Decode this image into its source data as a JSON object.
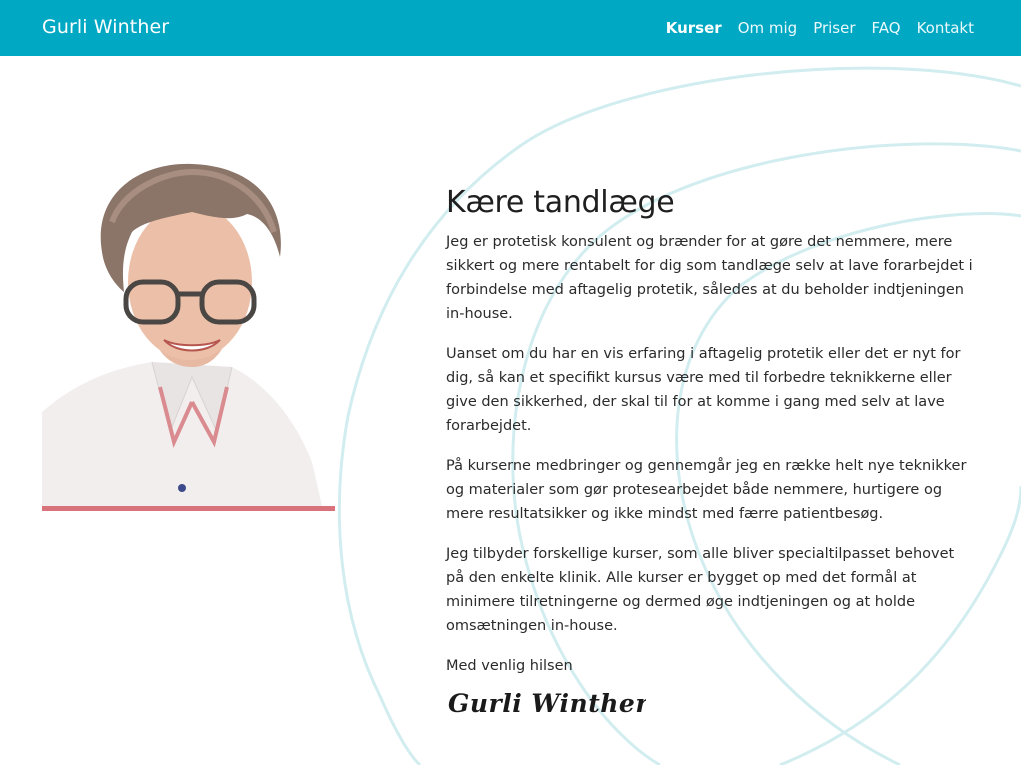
{
  "header": {
    "brand": "Gurli Winther",
    "nav": [
      {
        "label": "Kurser",
        "active": true
      },
      {
        "label": "Om mig"
      },
      {
        "label": "Priser"
      },
      {
        "label": "FAQ"
      },
      {
        "label": "Kontakt"
      }
    ]
  },
  "colors": {
    "header_bg": "#00a8c3",
    "accent_bar": "#d8737c",
    "swirl": "#cfecee"
  },
  "main": {
    "title": "Kære tandlæge",
    "paragraphs": [
      "Jeg er protetisk konsulent og brænder for at gøre det nemmere, mere sikkert og mere rentabelt for dig som tandlæge selv at lave forarbejdet i forbindelse med aftagelig protetik, således at du beholder indtjeningen in-house.",
      "Uanset om du har en vis erfaring i aftagelig protetik eller det er nyt for dig, så kan et specifikt kursus være med til forbedre teknikkerne eller give den sikkerhed, der skal til for at komme i gang med selv at lave forarbejdet.",
      "På kurserne medbringer og gennemgår jeg en række helt nye teknikker og materialer som gør protesearbejdet både nemmere, hurtigere og mere resultatsikker og ikke mindst med færre patientbesøg.",
      "Jeg tilbyder forskellige kurser, som alle bliver specialtilpasset behovet på den enkelte klinik. Alle kurser er bygget op med det formål at minimere tilretningerne og dermed øge indtjeningen og at holde omsætningen in-house."
    ],
    "greeting": "Med venlig hilsen",
    "signature": "Gurli Winther"
  }
}
